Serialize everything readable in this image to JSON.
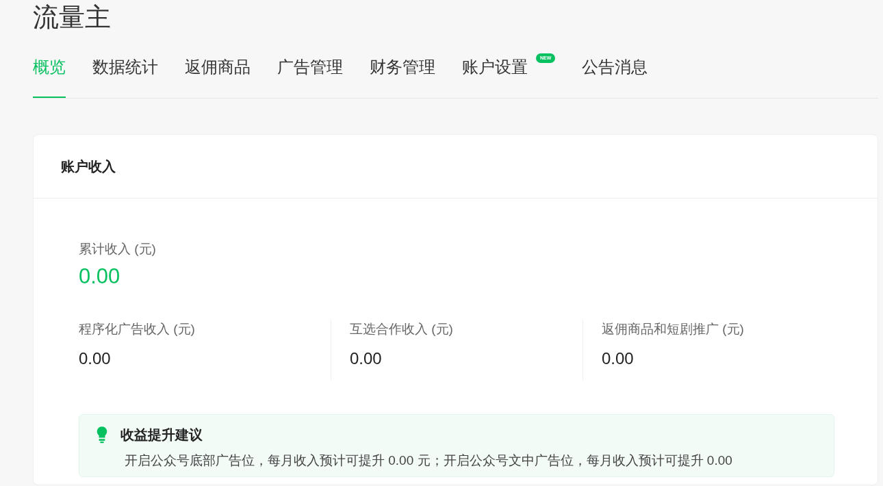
{
  "title": "流量主",
  "tabs": [
    {
      "label": "概览",
      "selected": true
    },
    {
      "label": "数据统计",
      "selected": false
    },
    {
      "label": "返佣商品",
      "selected": false
    },
    {
      "label": "广告管理",
      "selected": false
    },
    {
      "label": "财务管理",
      "selected": false
    },
    {
      "label": "账户设置",
      "selected": false,
      "badge": "NEW"
    },
    {
      "label": "公告消息",
      "selected": false
    }
  ],
  "card": {
    "title": "账户收入",
    "total": {
      "label": "累计收入 (元)",
      "value": "0.00"
    },
    "breakdown": [
      {
        "label": "程序化广告收入 (元)",
        "value": "0.00"
      },
      {
        "label": "互选合作收入 (元)",
        "value": "0.00"
      },
      {
        "label": "返佣商品和短剧推广 (元)",
        "value": "0.00"
      }
    ],
    "tip": {
      "title": "收益提升建议",
      "text": "开启公众号底部广告位，每月收入预计可提升 0.00 元；开启公众号文中广告位，每月收入预计可提升 0.00"
    }
  }
}
